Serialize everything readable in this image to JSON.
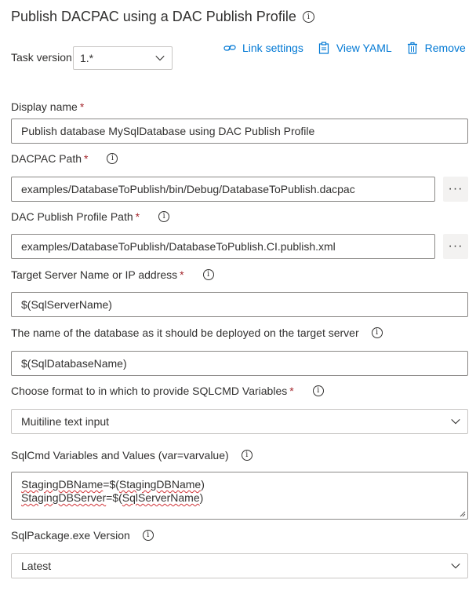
{
  "header": {
    "title": "Publish DACPAC using a DAC Publish Profile"
  },
  "task_version": {
    "label": "Task version",
    "value": "1.*"
  },
  "actions": [
    {
      "label": "Link settings",
      "icon": "link-icon"
    },
    {
      "label": "View YAML",
      "icon": "clipboard-icon"
    },
    {
      "label": "Remove",
      "icon": "trash-icon"
    }
  ],
  "fields": {
    "display_name": {
      "label": "Display name",
      "value": "Publish database MySqlDatabase using DAC Publish Profile"
    },
    "dacpac_path": {
      "label": "DACPAC Path",
      "value": "examples/DatabaseToPublish/bin/Debug/DatabaseToPublish.dacpac"
    },
    "publish_profile": {
      "label": "DAC Publish Profile Path",
      "value": "examples/DatabaseToPublish/DatabaseToPublish.CI.publish.xml"
    },
    "target_server": {
      "label": "Target Server Name or IP address",
      "value": "$(SqlServerName)"
    },
    "database_name": {
      "label": "The name of the database as it should be deployed on the target server",
      "value": "$(SqlDatabaseName)"
    },
    "sqlcmd_format": {
      "label": "Choose format to in which to provide SQLCMD Variables",
      "value": "Muitiline text input"
    },
    "sqlcmd_values": {
      "label": "SqlCmd Variables and Values (var=varvalue)",
      "line1_key": "StagingDBName",
      "line1_eq": "=$(",
      "line1_var": "StagingDBName",
      "line1_end": ")",
      "line2_key": "StagingDBServer",
      "line2_eq": "=$(",
      "line2_var": "SqlServerName",
      "line2_end": ")"
    },
    "sqlpackage_version": {
      "label": "SqlPackage.exe Version",
      "value": "Latest"
    }
  },
  "required_marker": "*",
  "ellipsis": "···",
  "info_glyph": "i"
}
